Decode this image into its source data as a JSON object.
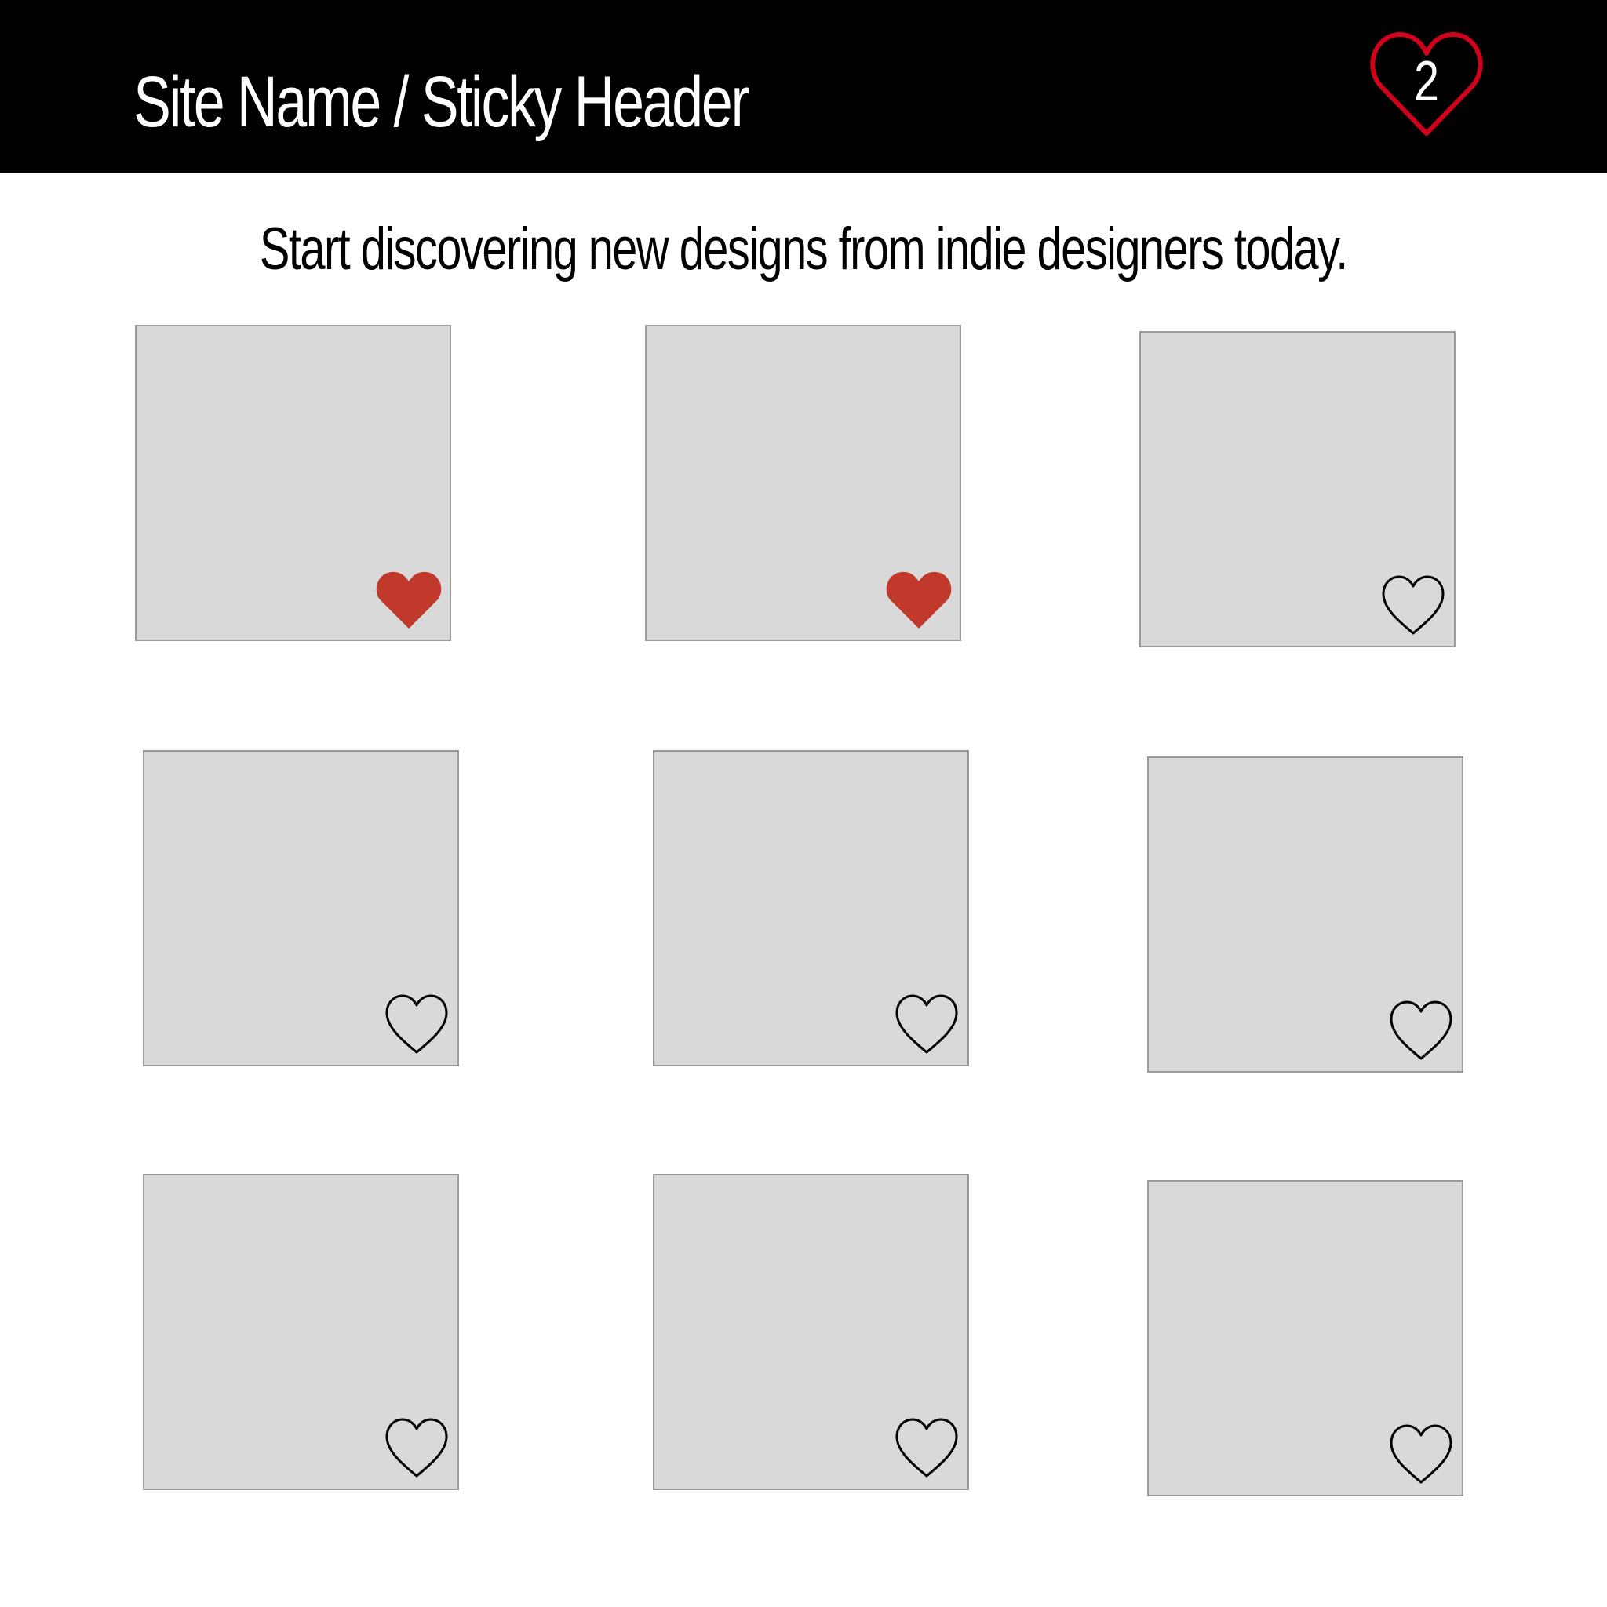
{
  "header": {
    "site_title": "Site Name / Sticky Header",
    "favorites_count": "2",
    "favorites_icon": "heart-outline-icon",
    "favorites_icon_color": "#d0021b"
  },
  "main": {
    "tagline": "Start discovering new designs from indie designers today."
  },
  "colors": {
    "header_bg": "#000000",
    "card_bg": "#d9d9d9",
    "card_border": "#9a9a9a",
    "favorited_heart": "#c0392b",
    "unfavorited_heart_stroke": "#000000"
  },
  "designs": [
    {
      "favorited": true
    },
    {
      "favorited": true
    },
    {
      "favorited": false
    },
    {
      "favorited": false
    },
    {
      "favorited": false
    },
    {
      "favorited": false
    },
    {
      "favorited": false
    },
    {
      "favorited": false
    },
    {
      "favorited": false
    }
  ]
}
